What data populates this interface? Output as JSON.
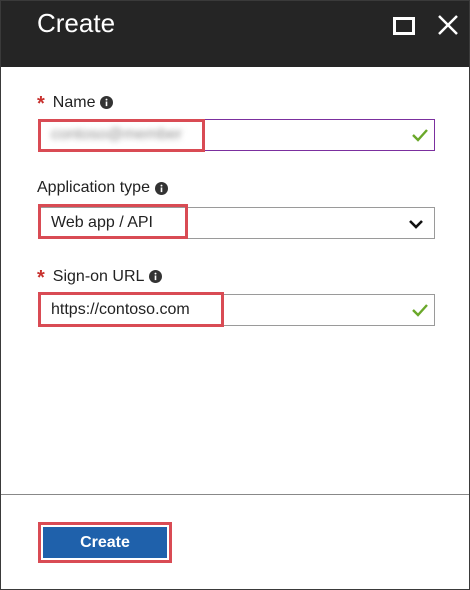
{
  "dialog": {
    "title": "Create"
  },
  "icons": {
    "maximize": "maximize-icon",
    "close": "close-icon",
    "info": "info-icon",
    "check": "checkmark-icon",
    "dropdown": "chevron-down-icon"
  },
  "fields": {
    "name": {
      "required_mark": "*",
      "label": "Name",
      "value_hint": "contoso@member"
    },
    "app_type": {
      "label": "Application type",
      "value": "Web app / API"
    },
    "sign_on_url": {
      "required_mark": "*",
      "label": "Sign-on URL",
      "value": "https://contoso.com"
    }
  },
  "footer": {
    "create_label": "Create"
  },
  "colors": {
    "header_bg": "#252525",
    "accent": "#1f61ab",
    "highlight": "#d94b54",
    "valid": "#6aa82a",
    "focus_border": "#7b2f9e"
  }
}
